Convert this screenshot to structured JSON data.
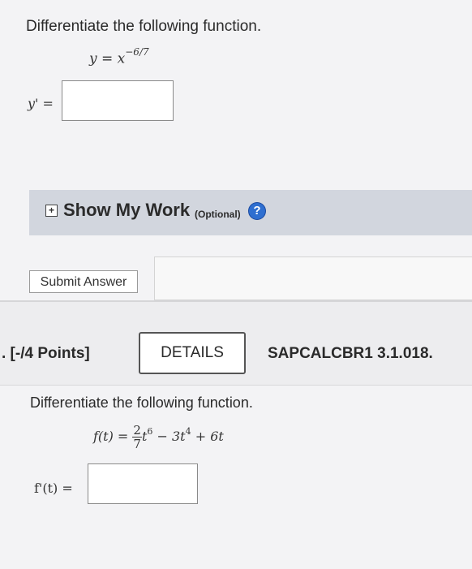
{
  "question1": {
    "prompt": "Differentiate the following function.",
    "equation_lhs": "y = x",
    "equation_exponent": "−6/7",
    "answer_label": "y' =",
    "answer_value": ""
  },
  "show_work": {
    "label": "Show My Work",
    "optional": "(Optional)",
    "help_glyph": "?"
  },
  "submit_label": "Submit Answer",
  "question2_header": {
    "points": ". [-/4 Points]",
    "details_label": "DETAILS",
    "code": "SAPCALCBR1 3.1.018."
  },
  "question2": {
    "prompt": "Differentiate the following function.",
    "equation_lhs": "f(t) =",
    "frac_num": "2",
    "frac_den": "7",
    "term1_base": "t",
    "term1_exp": "6",
    "term2": "− 3t",
    "term2_exp": "4",
    "term3": "+ 6t",
    "answer_label": "f'(t) =",
    "answer_value": ""
  },
  "icons": {
    "expand": "plus-square-icon",
    "help": "help-circle-icon"
  },
  "colors": {
    "help_icon": "#2f6fd0",
    "show_work_bar": "#d2d6de"
  }
}
